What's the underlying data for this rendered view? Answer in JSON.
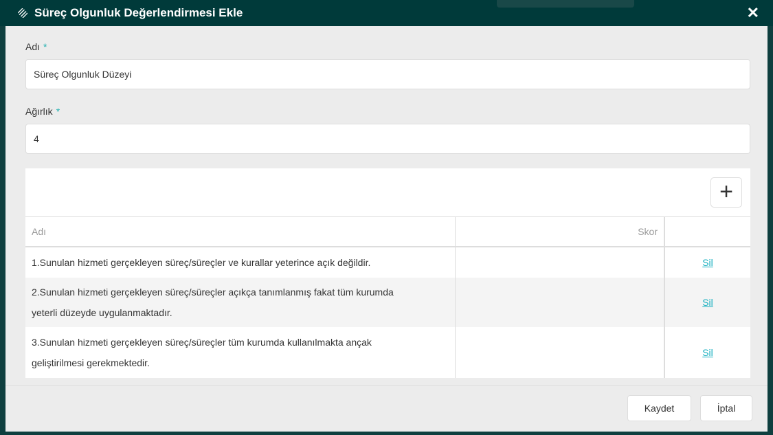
{
  "dialog": {
    "title": "Süreç Olgunluk Değerlendirmesi Ekle",
    "close": "✕"
  },
  "form": {
    "name_label": "Adı",
    "name_value": "Süreç Olgunluk Düzeyi",
    "weight_label": "Ağırlık",
    "weight_value": "4",
    "required": "*"
  },
  "table": {
    "add": "+",
    "headers": [
      "Adı",
      "Skor",
      ""
    ],
    "rows": [
      {
        "name": "1.Sunulan hizmeti gerçekleyen süreç/süreçler ve kurallar yeterince açık değildir.",
        "score": "",
        "action": "Sil"
      },
      {
        "name": "2.Sunulan hizmeti gerçekleyen süreç/süreçler açıkça tanımlanmış fakat tüm kurumda yeterli düzeyde uygulanmaktadır.",
        "score": "",
        "action": "Sil"
      },
      {
        "name": "3.Sunulan hizmeti gerçekleyen süreç/süreçler tüm kurumda kullanılmakta ançak geliştirilmesi gerekmektedir.",
        "score": "",
        "action": "Sil"
      }
    ]
  },
  "footer": {
    "save": "Kaydet",
    "cancel": "İptal"
  }
}
